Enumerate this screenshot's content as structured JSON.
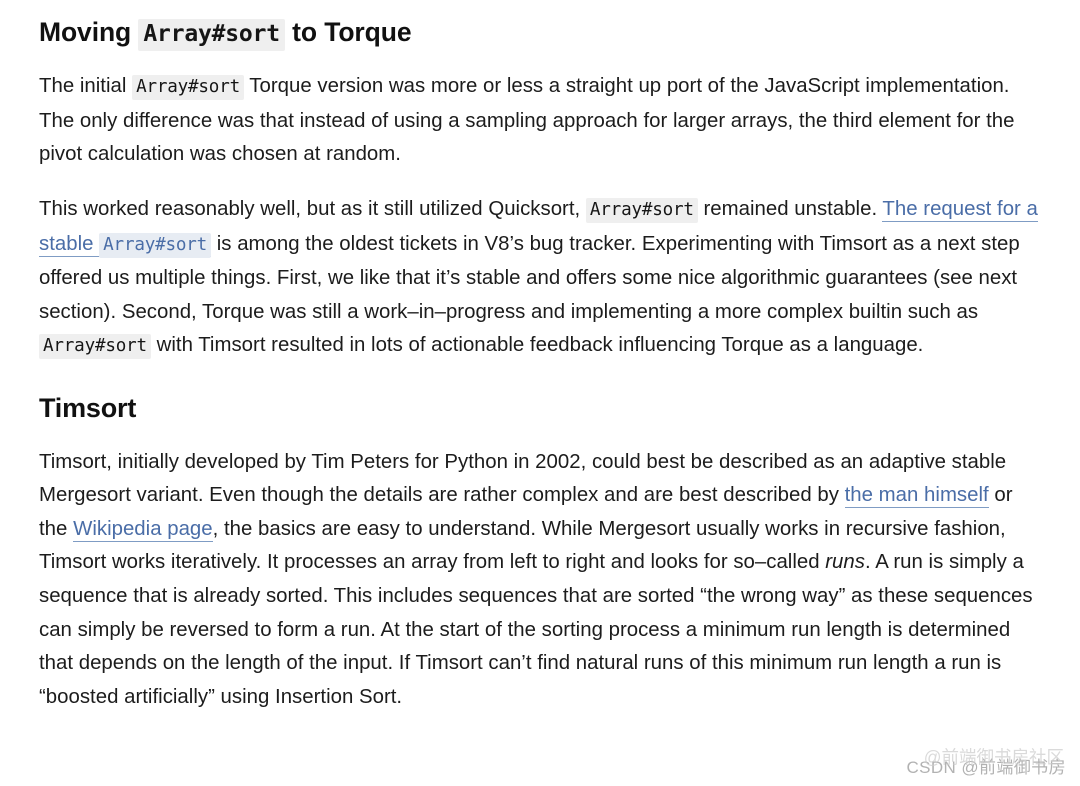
{
  "document": {
    "title_parts": {
      "before": "Moving ",
      "code": "Array#sort",
      "after": " to Torque"
    },
    "paragraph1": {
      "t1": "The initial ",
      "code1": "Array#sort",
      "t2": " Torque version was more or less a straight up port of the JavaScript implementation. The only difference was that instead of using a sampling approach for larger arrays, the third element for the pivot calculation was chosen at random."
    },
    "paragraph2": {
      "t1": "This worked reasonably well, but as it still utilized Quicksort, ",
      "code1": "Array#sort",
      "t2": " remained unstable. ",
      "link1_pre": "The request for a stable ",
      "link1_code": "Array#sort",
      "t3": " is among the oldest tickets in V8’s bug tracker. Experimenting with Timsort as a next step offered us multiple things. First, we like that it’s stable and offers some nice algorithmic guarantees (see next section). Second, Torque was still a work–in–progress and implementing a more complex builtin such as ",
      "code2": "Array#sort",
      "t4": " with Timsort resulted in lots of actionable feedback influencing Torque as a language."
    },
    "section_heading": "Timsort",
    "paragraph3": {
      "t1": "Timsort, initially developed by Tim Peters for Python in 2002, could best be described as an adaptive stable Mergesort variant. Even though the details are rather complex and are best described by ",
      "link_man": "the man himself",
      "t2": " or the ",
      "link_wiki": "Wikipedia page",
      "t3": ", the basics are easy to understand. While Mergesort usually works in recursive fashion, Timsort works iteratively. It processes an array from left to right and looks for so–called ",
      "em1": "runs",
      "t4": ". A run is simply a sequence that is already sorted. This includes sequences that are sorted “the wrong way” as these sequences can simply be reversed to form a run. At the start of the sorting process a minimum run length is determined that depends on the length of the input. If Timsort can’t find natural runs of this minimum run length a run is “boosted artificially” using Insertion Sort."
    }
  },
  "watermark": {
    "main": "CSDN @前端御书房",
    "ghost": "@前端御书房社区"
  },
  "colors": {
    "link": "#4a6da7",
    "code_background": "#efefef",
    "link_code_background": "#e7ecf3",
    "text": "#1c1c1c",
    "watermark": "#b2b2b2"
  }
}
